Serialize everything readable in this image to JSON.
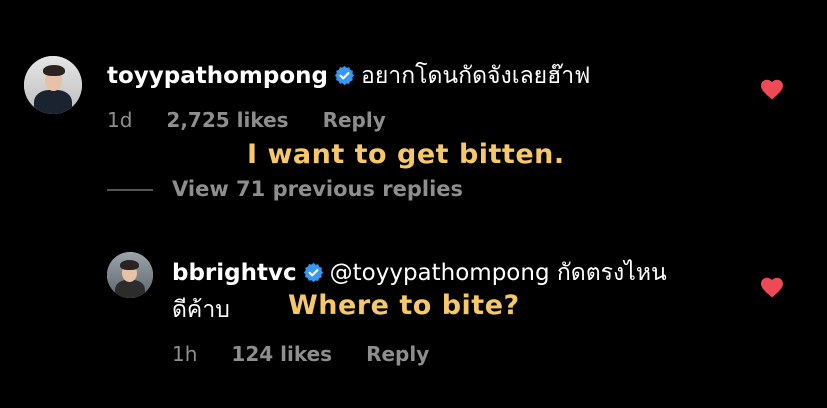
{
  "comments": [
    {
      "username": "toyypathompong",
      "text": "อยากโดนกัดจังเลยฮ๊าฟ",
      "time": "1d",
      "likes": "2,725 likes",
      "reply": "Reply",
      "translation": "I want to get bitten."
    },
    {
      "username": "bbrightvc",
      "mention": "@toyypathompong",
      "text_line1": "กัดตรงไหน",
      "text_line2": "ดีค้าบ",
      "time": "1h",
      "likes": "124 likes",
      "reply": "Reply",
      "translation": "Where to bite?"
    }
  ],
  "view_replies": "View 71 previous replies",
  "colors": {
    "background": "#000000",
    "text": "#ffffff",
    "meta": "#8e8e8e",
    "verified": "#3897f0",
    "heart": "#ed4956",
    "translation": "#f6c86a"
  },
  "icons": [
    "verified-badge-icon",
    "heart-icon"
  ]
}
